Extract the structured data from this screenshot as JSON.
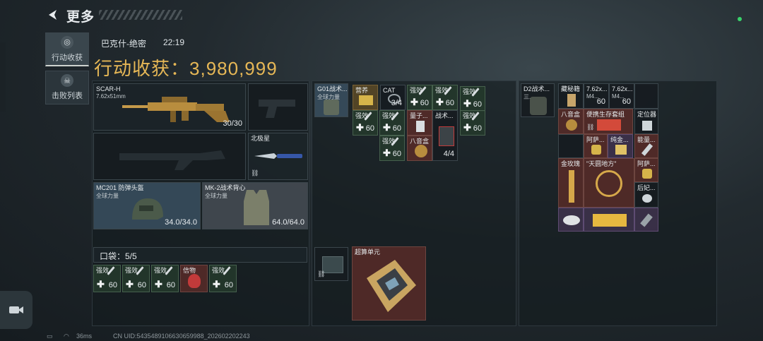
{
  "header": {
    "title": "更多",
    "back_icon": "arrow-left-icon"
  },
  "tabs": [
    {
      "label": "行动收获",
      "icon": "target-icon",
      "active": true
    },
    {
      "label": "击败列表",
      "icon": "skull-icon",
      "active": false
    }
  ],
  "raid": {
    "map": "巴克什-绝密",
    "time": "22:19",
    "summary_label": "行动收获：",
    "summary_value": "3,980,999"
  },
  "equipment": {
    "primary": {
      "name": "SCAR-H",
      "caliber": "7.62x51mm",
      "ammo": "30/30"
    },
    "melee": {
      "name": "北极星"
    },
    "helmet": {
      "name": "MC201 防弹头盔",
      "sub": "全球力量",
      "durability": "34.0/34.0"
    },
    "vest": {
      "name": "MK-2战术背心",
      "sub": "全球力量",
      "durability": "64.0/64.0"
    }
  },
  "pocket": {
    "label": "口袋：5/5",
    "items": [
      {
        "label": "强效",
        "count": "60"
      },
      {
        "label": "强效",
        "count": "60"
      },
      {
        "label": "强效",
        "count": "60"
      },
      {
        "label": "信物",
        "count": ""
      },
      {
        "label": "强效",
        "count": "60"
      }
    ]
  },
  "rig": {
    "name": "G01战术...",
    "sub": "全球力量",
    "items": [
      {
        "label": "营养",
        "count": ""
      },
      {
        "label": "CAT",
        "count": "3/4"
      },
      {
        "label": "强效",
        "count": "60"
      },
      {
        "label": "强效",
        "count": "60"
      },
      {
        "label": "强效",
        "count": "60"
      },
      {
        "label": "强效",
        "count": "60"
      },
      {
        "label": "强效",
        "count": "60"
      },
      {
        "label": "量子...",
        "count": ""
      },
      {
        "label": "战术...",
        "count": "4/4"
      },
      {
        "label": "强效",
        "count": "60"
      },
      {
        "label": "强效",
        "count": "60"
      },
      {
        "label": "八音盒",
        "count": ""
      }
    ]
  },
  "case": {
    "label": "超算单元"
  },
  "backpack": {
    "name": "D2战术...",
    "sub": "三...",
    "items": [
      {
        "label": "藏秘籍",
        "count": ""
      },
      {
        "label": "7.62x...",
        "sub": "M4...",
        "count": "60"
      },
      {
        "label": "7.62x...",
        "sub": "M4...",
        "count": "60"
      },
      {
        "label": "八音盒",
        "count": ""
      },
      {
        "label": "便携生存套组",
        "count": ""
      },
      {
        "label": "定位器",
        "count": ""
      },
      {
        "label": "阿萨...",
        "count": ""
      },
      {
        "label": "纯金...",
        "count": ""
      },
      {
        "label": "能量...",
        "count": ""
      },
      {
        "label": "金玫瑰",
        "count": ""
      },
      {
        "label": "\"天圆地方\"",
        "count": ""
      },
      {
        "label": "阿萨...",
        "count": ""
      },
      {
        "label": "后妃...",
        "count": ""
      }
    ]
  },
  "status_bar": {
    "ping": "36ms",
    "uid": "CN UID:5435489106630659988_202602202243"
  }
}
